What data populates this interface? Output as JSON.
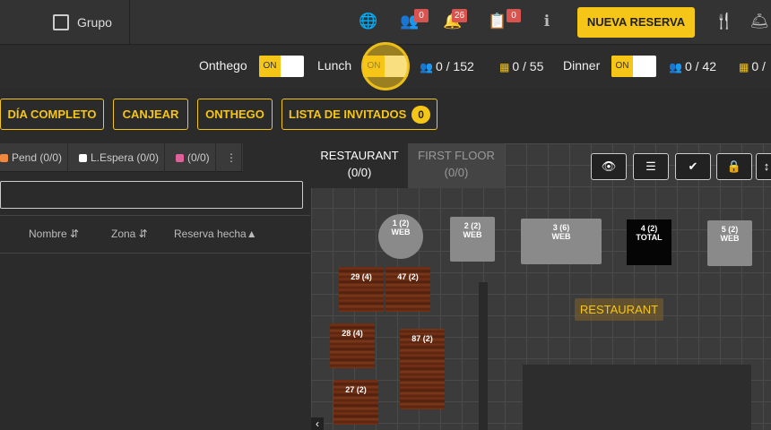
{
  "topbar": {
    "grupo_label": "Grupo",
    "icons": [
      {
        "name": "globe-icon",
        "glyph": "🌐"
      },
      {
        "name": "users-icon",
        "glyph": "👥",
        "badge": "0"
      },
      {
        "name": "bell-icon",
        "glyph": "🔔",
        "badge": "26"
      },
      {
        "name": "clipboard-icon",
        "glyph": "📋",
        "badge": "0"
      },
      {
        "name": "info-icon",
        "glyph": "ℹ"
      }
    ],
    "new_reservation_label": "NUEVA RESERVA",
    "utensils_icon": "🍴",
    "service_icon": "🛎"
  },
  "shifts": {
    "onthego": {
      "label": "Onthego",
      "toggle": "ON"
    },
    "lunch": {
      "label": "Lunch",
      "toggle": "ON",
      "people": "0 / 152",
      "tables": "0 / 55"
    },
    "dinner": {
      "label": "Dinner",
      "toggle": "ON",
      "people": "0 / 42",
      "tables": "0 /"
    }
  },
  "filters": {
    "dia_completo": "DÍA COMPLETO",
    "canjear": "CANJEAR",
    "onthego": "ONTHEGO",
    "lista_invitados": "LISTA DE INVITADOS",
    "lista_count": "0"
  },
  "left_panel": {
    "tabs": [
      {
        "label": "Pend (0/0)",
        "color": "#f0883e"
      },
      {
        "label": "L.Espera (0/0)",
        "color": "#ffffff"
      },
      {
        "label": "(0/0)",
        "color": "#e0609a"
      }
    ],
    "more": "⋮",
    "columns": [
      "Nombre ⇵",
      "Zona ⇵",
      "Reserva hecha▲"
    ]
  },
  "plan": {
    "tabs": [
      {
        "name": "RESTAURANT",
        "count": "(0/0)"
      },
      {
        "name": "FIRST FLOOR",
        "count": "(0/0)"
      }
    ],
    "toolbar_icons": [
      "eye-icon",
      "list-icon",
      "check-circle-icon",
      "lock-icon",
      "sort-vertical-icon"
    ],
    "zone_label": "RESTAURANT",
    "tables": [
      {
        "id": "1 (2)",
        "sub": "WEB"
      },
      {
        "id": "2 (2)",
        "sub": "WEB"
      },
      {
        "id": "3 (6)",
        "sub": "WEB"
      },
      {
        "id": "4 (2)",
        "sub": "TOTAL"
      },
      {
        "id": "5 (2)",
        "sub": "WEB"
      },
      {
        "id": "29 (4)"
      },
      {
        "id": "47 (2)"
      },
      {
        "id": "28 (4)"
      },
      {
        "id": "87 (2)"
      },
      {
        "id": "27 (2)"
      }
    ]
  }
}
